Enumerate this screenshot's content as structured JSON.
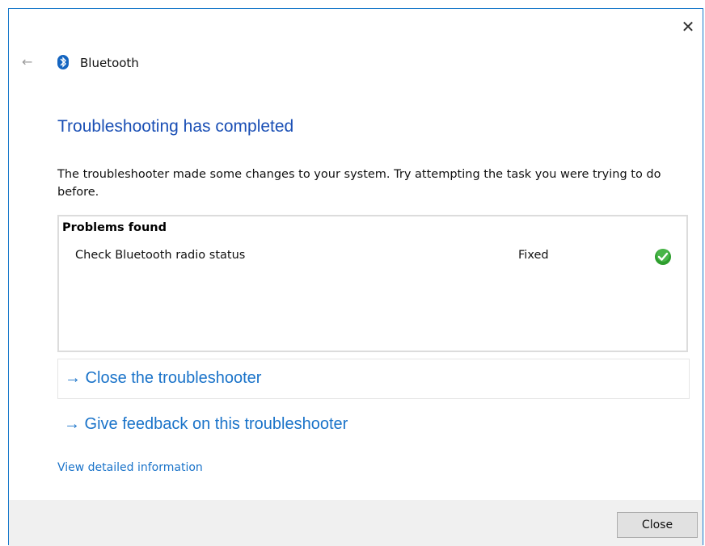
{
  "header": {
    "app_title": "Bluetooth",
    "close_glyph": "✕",
    "back_glyph": "←",
    "icon": "bluetooth-icon"
  },
  "main": {
    "heading": "Troubleshooting has completed",
    "description": "The troubleshooter made some changes to your system. Try attempting the task you were trying to do before.",
    "problems": {
      "title": "Problems found",
      "rows": [
        {
          "name": "Check Bluetooth radio status",
          "status": "Fixed",
          "status_icon": "check-circle-icon"
        }
      ]
    },
    "links": {
      "close_troubleshooter": "→ Close the troubleshooter",
      "give_feedback": "→ Give feedback on this troubleshooter",
      "view_details": "View detailed information"
    }
  },
  "footer": {
    "close_label": "Close"
  },
  "colors": {
    "heading": "#1a4fb5",
    "link": "#1a73c9",
    "success": "#2e9e2e"
  }
}
